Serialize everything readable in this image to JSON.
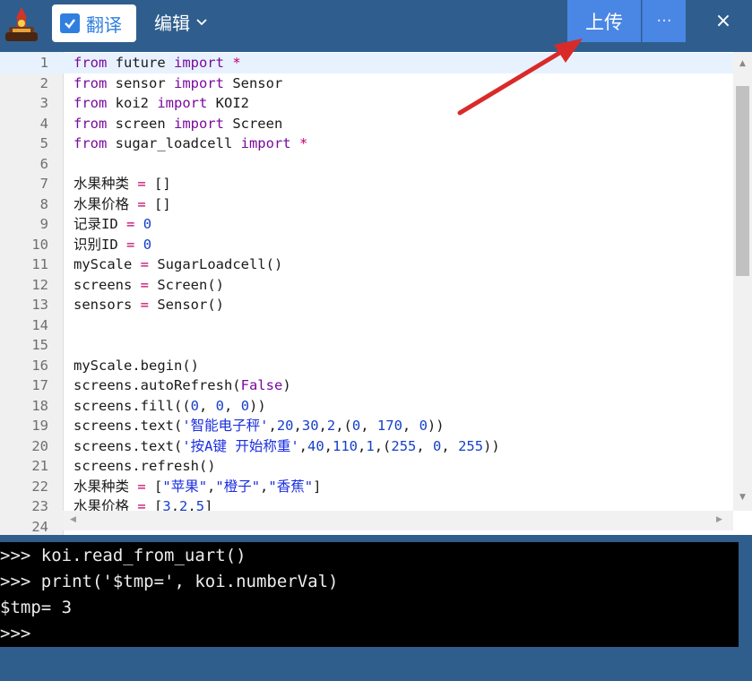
{
  "toolbar": {
    "translate_label": "翻译",
    "edit_label": "编辑",
    "upload_label": "上传",
    "more_label": "···",
    "close_label": "×"
  },
  "colors": {
    "topbar": "#2f5e8e",
    "accent": "#4a86e4",
    "console_bg": "#000000",
    "annotation_arrow": "#e02020"
  },
  "editor": {
    "lines": [
      {
        "n": "1",
        "text": "from future import *"
      },
      {
        "n": "2",
        "text": "from sensor import Sensor"
      },
      {
        "n": "3",
        "text": "from koi2 import KOI2"
      },
      {
        "n": "4",
        "text": "from screen import Screen"
      },
      {
        "n": "5",
        "text": "from sugar_loadcell import *"
      },
      {
        "n": "6",
        "text": ""
      },
      {
        "n": "7",
        "text": "水果种类 = []"
      },
      {
        "n": "8",
        "text": "水果价格 = []"
      },
      {
        "n": "9",
        "text": "记录ID = 0"
      },
      {
        "n": "10",
        "text": "识别ID = 0"
      },
      {
        "n": "11",
        "text": "myScale = SugarLoadcell()"
      },
      {
        "n": "12",
        "text": "screens = Screen()"
      },
      {
        "n": "13",
        "text": "sensors = Sensor()"
      },
      {
        "n": "14",
        "text": ""
      },
      {
        "n": "15",
        "text": ""
      },
      {
        "n": "16",
        "text": "myScale.begin()"
      },
      {
        "n": "17",
        "text": "screens.autoRefresh(False)"
      },
      {
        "n": "18",
        "text": "screens.fill((0, 0, 0))"
      },
      {
        "n": "19",
        "text": "screens.text('智能电子秤',20,30,2,(0, 170, 0))"
      },
      {
        "n": "20",
        "text": "screens.text('按A键 开始称重',40,110,1,(255, 0, 255))"
      },
      {
        "n": "21",
        "text": "screens.refresh()"
      },
      {
        "n": "22",
        "text": "水果种类 = [\"苹果\",\"橙子\",\"香蕉\"]"
      },
      {
        "n": "23",
        "text": "水果价格 = [3,2,5]"
      },
      {
        "n": "24",
        "text": ""
      }
    ]
  },
  "console": {
    "lines": [
      ">>> koi.read_from_uart()",
      ">>> print('$tmp=', koi.numberVal)",
      "$tmp= 3",
      ">>>"
    ]
  }
}
